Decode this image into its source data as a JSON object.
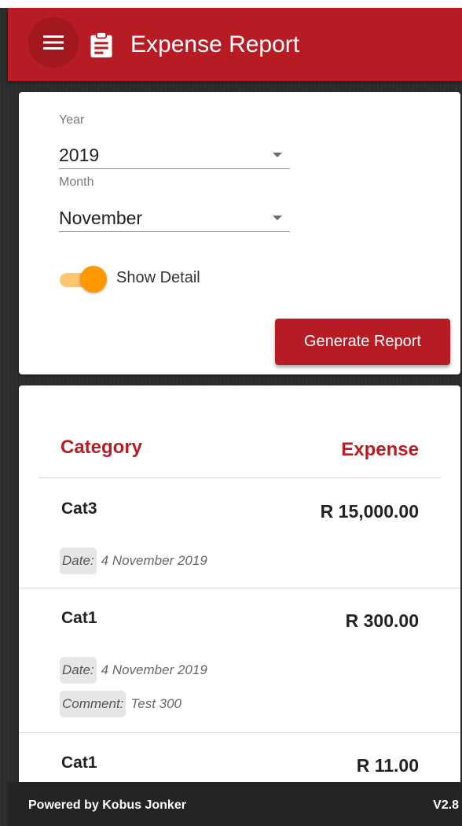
{
  "app_bar": {
    "title": "Expense Report",
    "menu_icon": "hamburger-menu-icon",
    "report_icon": "clipboard-icon",
    "background": "#b71c24"
  },
  "filters": {
    "year_label": "Year",
    "year_value": "2019",
    "month_label": "Month",
    "month_value": "November",
    "show_detail_label": "Show Detail",
    "show_detail_on": true,
    "generate_button": "Generate Report"
  },
  "report": {
    "headers": {
      "category": "Category",
      "expense": "Expense"
    },
    "rows": [
      {
        "category": "Cat3",
        "amount": "R 15,000.00",
        "date_label": "Date:",
        "date": "4 November 2019"
      },
      {
        "category": "Cat1",
        "amount": "R 300.00",
        "date_label": "Date:",
        "date": "4 November 2019",
        "comment_label": "Comment:",
        "comment": "Test 300"
      },
      {
        "category": "Cat1",
        "amount": "R 11.00"
      }
    ]
  },
  "footer": {
    "powered_by": "Powered by Kobus Jonker",
    "version": "V2.8"
  },
  "colors": {
    "accent": "#b71c24",
    "toggle": "#ff9800",
    "footer": "#222425"
  }
}
